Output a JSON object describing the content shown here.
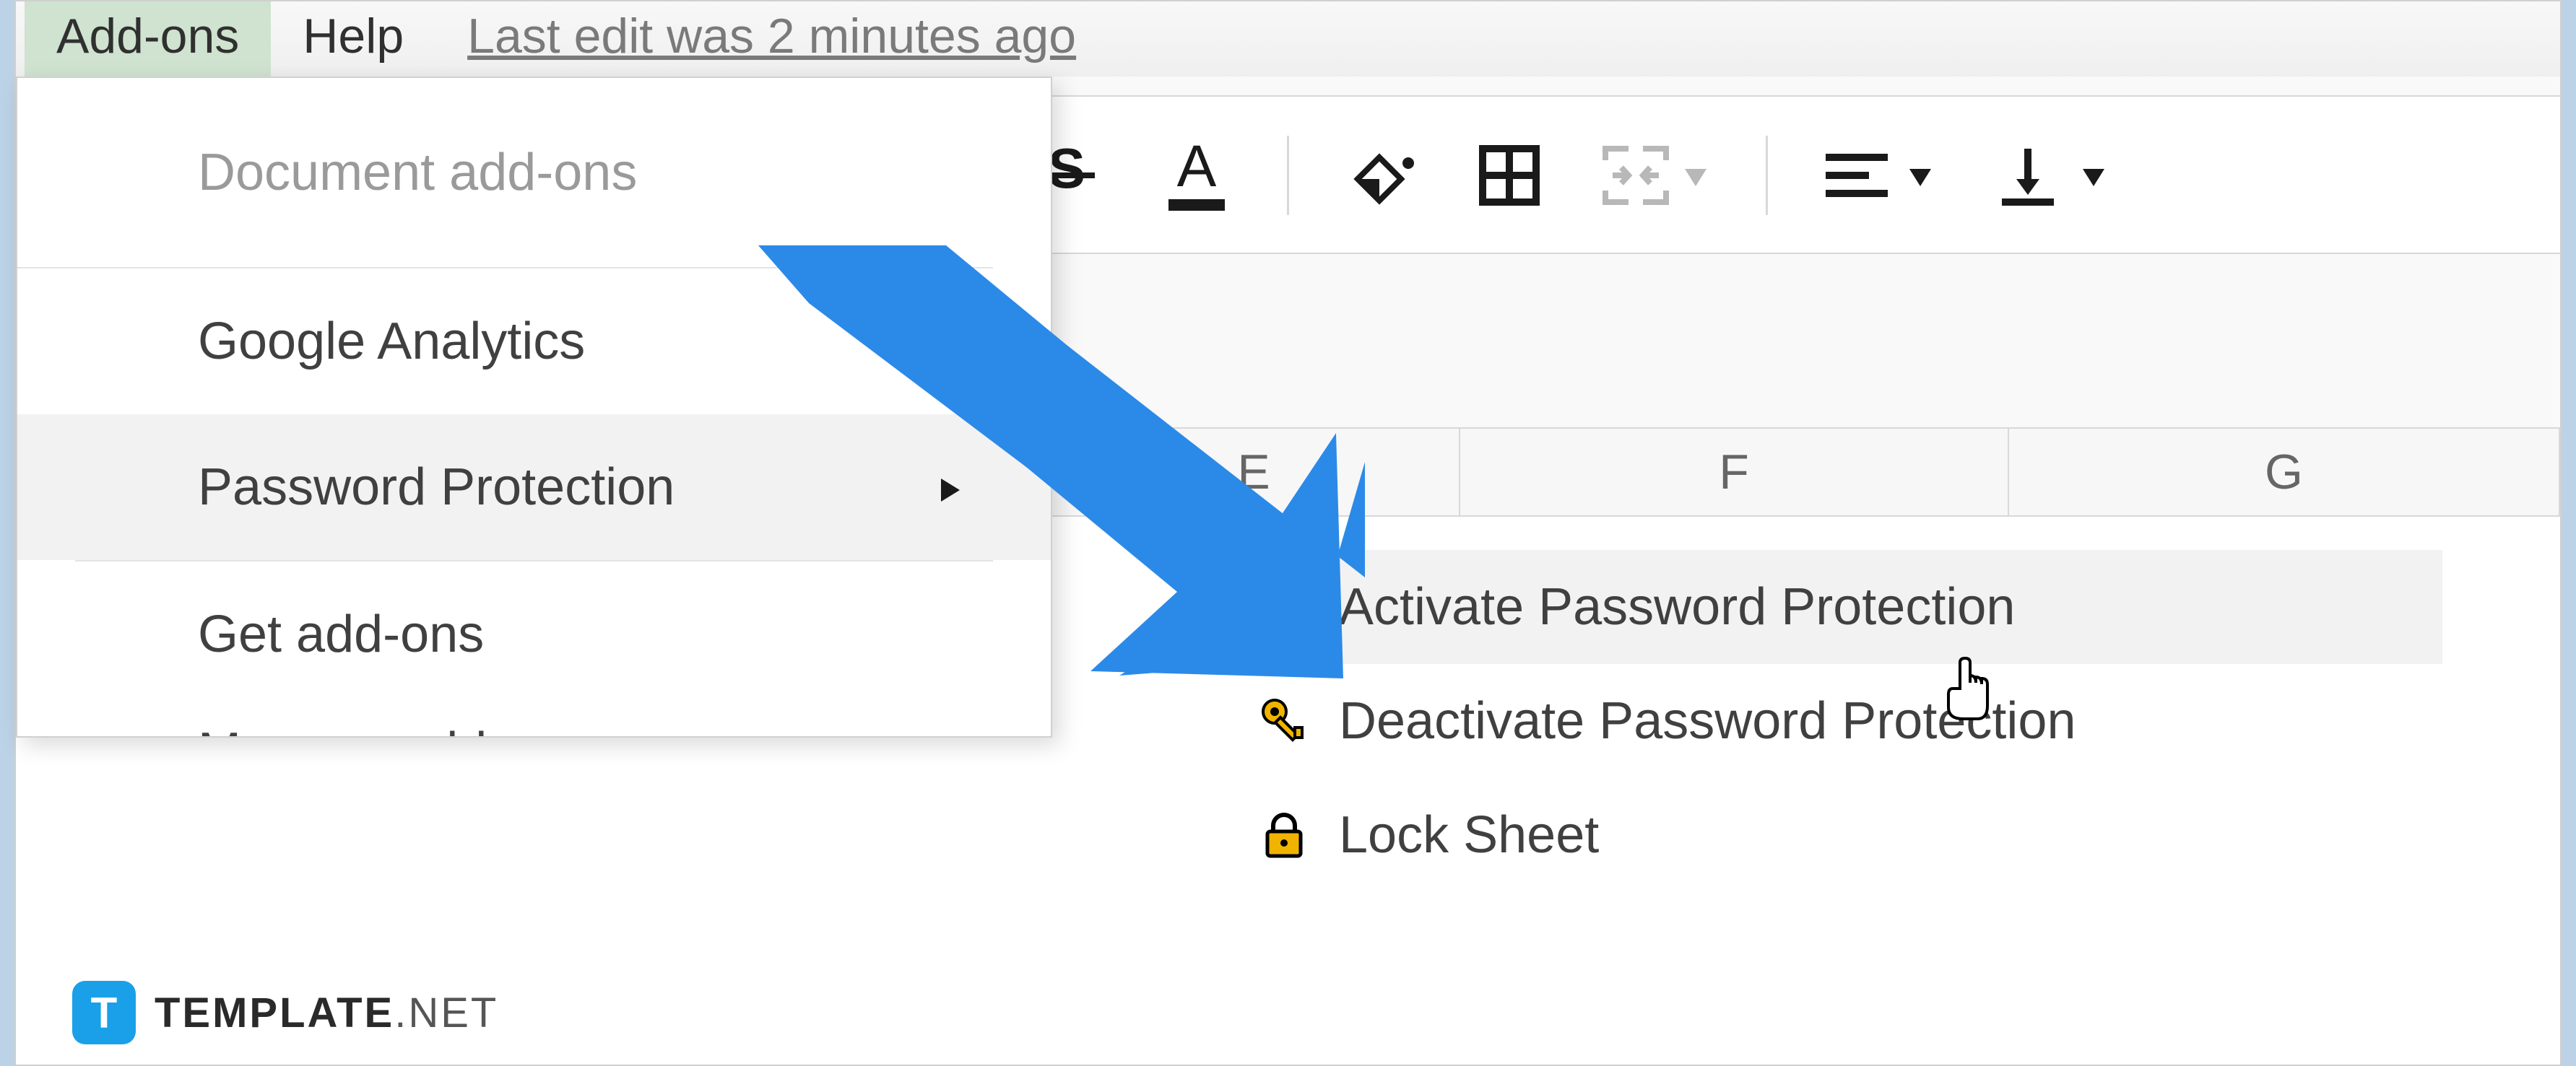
{
  "menubar": {
    "addons": "Add-ons",
    "help": "Help",
    "last_edit": "Last edit was 2 minutes ago"
  },
  "columns": {
    "e": "E",
    "f": "F",
    "g": "G"
  },
  "dropdown": {
    "header": "Document add-ons",
    "item_analytics": "Google Analytics",
    "item_password": "Password Protection",
    "item_get": "Get add-ons",
    "item_manage": "Manage add-ons"
  },
  "submenu": {
    "activate": "Activate Password Protection",
    "deactivate": "Deactivate Password Protection",
    "lock": "Lock Sheet"
  },
  "watermark": {
    "badge": "T",
    "bold": "TEMPLATE",
    "thin": ".NET"
  }
}
